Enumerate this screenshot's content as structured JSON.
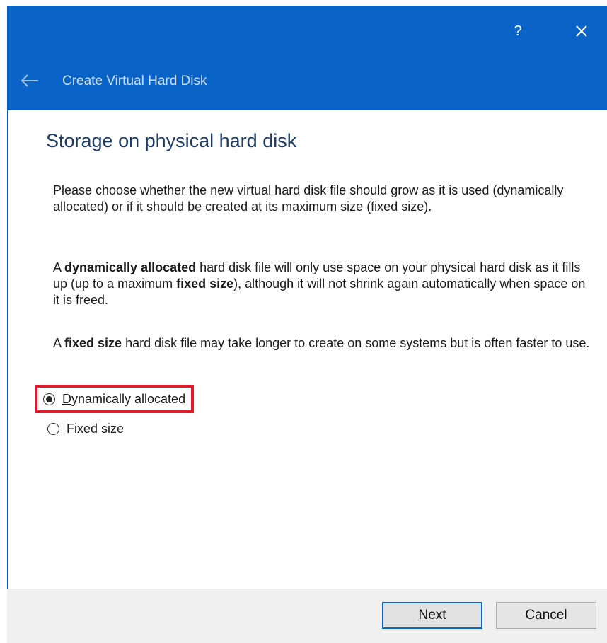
{
  "titlebar": {
    "help_label": "?",
    "close_icon": "close-icon",
    "back_icon": "back-arrow-icon",
    "title": "Create Virtual Hard Disk",
    "color": "#0a64c8"
  },
  "page": {
    "heading": "Storage on physical hard disk",
    "para1": "Please choose whether the new virtual hard disk file should grow as it is used (dynamically allocated) or if it should be created at its maximum size (fixed size).",
    "para2": {
      "pre": "A ",
      "bold1": "dynamically allocated",
      "mid": " hard disk file will only use space on your physical hard disk as it fills up (up to a maximum ",
      "bold2": "fixed size",
      "post": "), although it will not shrink again automatically when space on it is freed."
    },
    "para3": {
      "pre": "A ",
      "bold": "fixed size",
      "post": " hard disk file may take longer to create on some systems but is often faster to use."
    }
  },
  "options": [
    {
      "mnemonic": "D",
      "rest": "ynamically allocated",
      "checked": true
    },
    {
      "mnemonic": "F",
      "rest": "ixed size",
      "checked": false
    }
  ],
  "highlight_color": "#e21a2b",
  "footer": {
    "next_mnemonic": "N",
    "next_rest": "ext",
    "cancel_label": "Cancel"
  }
}
